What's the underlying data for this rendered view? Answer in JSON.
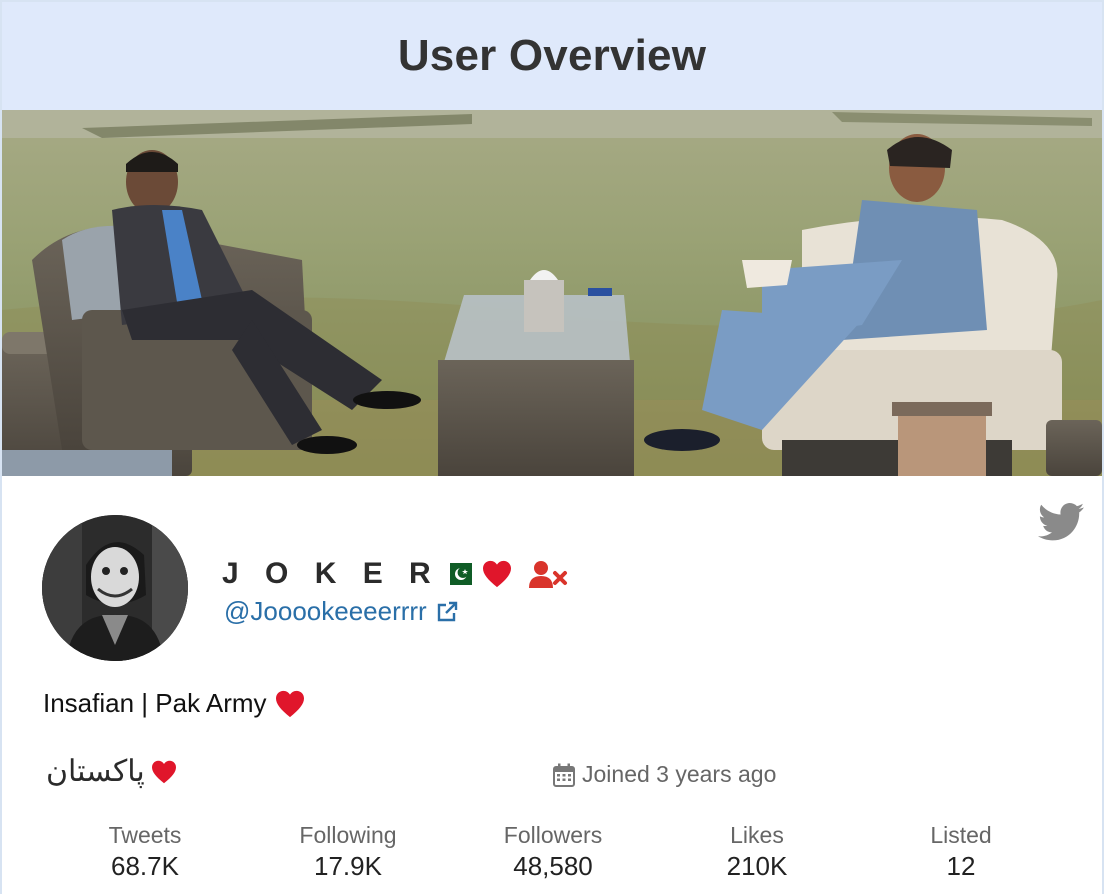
{
  "header": {
    "title": "User Overview"
  },
  "banner": {
    "alt": "Two men seated in wicker chairs facing each other on a lawn"
  },
  "profile": {
    "display_name": "J O K E R",
    "handle": "@Jooookeeeerrrr",
    "bio": "Insafian | Pak Army",
    "location": "پاکستان",
    "joined": "Joined 3 years ago"
  },
  "stats": [
    {
      "label": "Tweets",
      "value": "68.7K"
    },
    {
      "label": "Following",
      "value": "17.9K"
    },
    {
      "label": "Followers",
      "value": "48,580"
    },
    {
      "label": "Likes",
      "value": "210K"
    },
    {
      "label": "Listed",
      "value": "12"
    }
  ],
  "icons": {
    "twitter": "twitter-bird-icon",
    "unfollow": "user-times-icon",
    "external": "external-link-icon",
    "calendar": "calendar-icon",
    "flag": "pakistan-flag-icon",
    "heart": "red-heart-icon"
  },
  "colors": {
    "header_bg": "#dfe9fb",
    "link": "#2a6fa8",
    "unfollow": "#d9342b",
    "muted": "#666666",
    "heart": "#e0162b"
  }
}
